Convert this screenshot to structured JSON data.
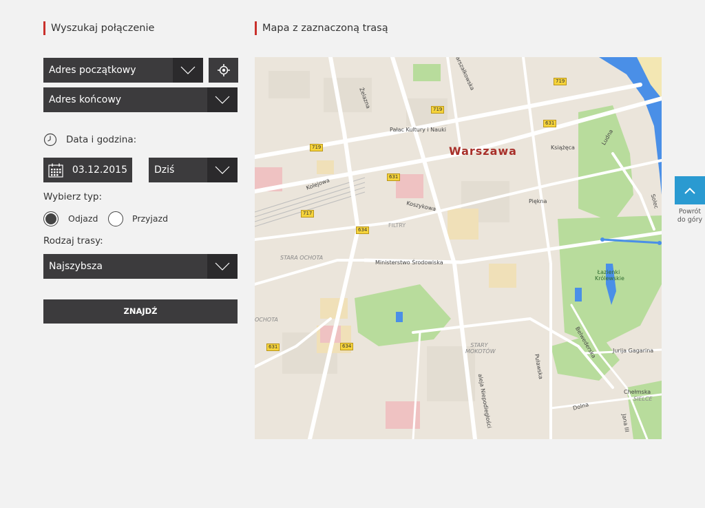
{
  "search": {
    "title": "Wyszukaj połączenie",
    "start_address": "Adres początkowy",
    "end_address": "Adres końcowy",
    "datetime_label": "Data i godzina:",
    "date_value": "03.12.2015",
    "day_value": "Dziś",
    "type_label": "Wybierz typ:",
    "type_options": [
      "Odjazd",
      "Przyjazd"
    ],
    "type_selected": "Odjazd",
    "route_label": "Rodzaj trasy:",
    "route_value": "Najszybsza",
    "submit_label": "ZNAJDŹ"
  },
  "map": {
    "title": "Mapa z zaznaczoną trasą",
    "city_label": "Warszawa",
    "places": [
      "Pałac Kultury i Nauki",
      "Ministerstwo Środowiska",
      "Łazienki Królewskie",
      "FILTRY",
      "STARA OCHOTA",
      "OCHOTA",
      "STARY MOKOTÓW",
      "SIELCE"
    ],
    "streets": [
      "Marszałkowska",
      "Żelazna",
      "Kolejowa",
      "Koszykowa",
      "Piękna",
      "Książęca",
      "Ludna",
      "Solec",
      "Puławska",
      "Belwederska",
      "Jurija Gagarina",
      "Chełmska",
      "Dolna",
      "aleja Niepodległości",
      "Jana III"
    ],
    "road_shields": [
      "719",
      "719",
      "719",
      "631",
      "631",
      "631",
      "717",
      "634",
      "634"
    ]
  },
  "back_to_top": {
    "label_line1": "Powrót",
    "label_line2": "do góry"
  },
  "colors": {
    "accent": "#c9302c",
    "dark": "#3c3b3d",
    "top_button": "#2a9ad1"
  }
}
